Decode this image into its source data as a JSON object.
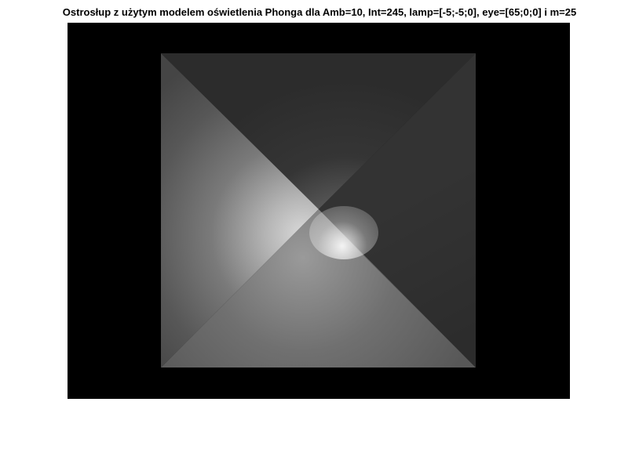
{
  "figure": {
    "title": "Ostrosłup z użytym modelem oświetlenia Phonga dla Amb=10, Int=245, lamp=[-5;-5;0], eye=[65;0;0] i m=25",
    "background_color": "#ffffff",
    "image_background_color": "#000000"
  }
}
